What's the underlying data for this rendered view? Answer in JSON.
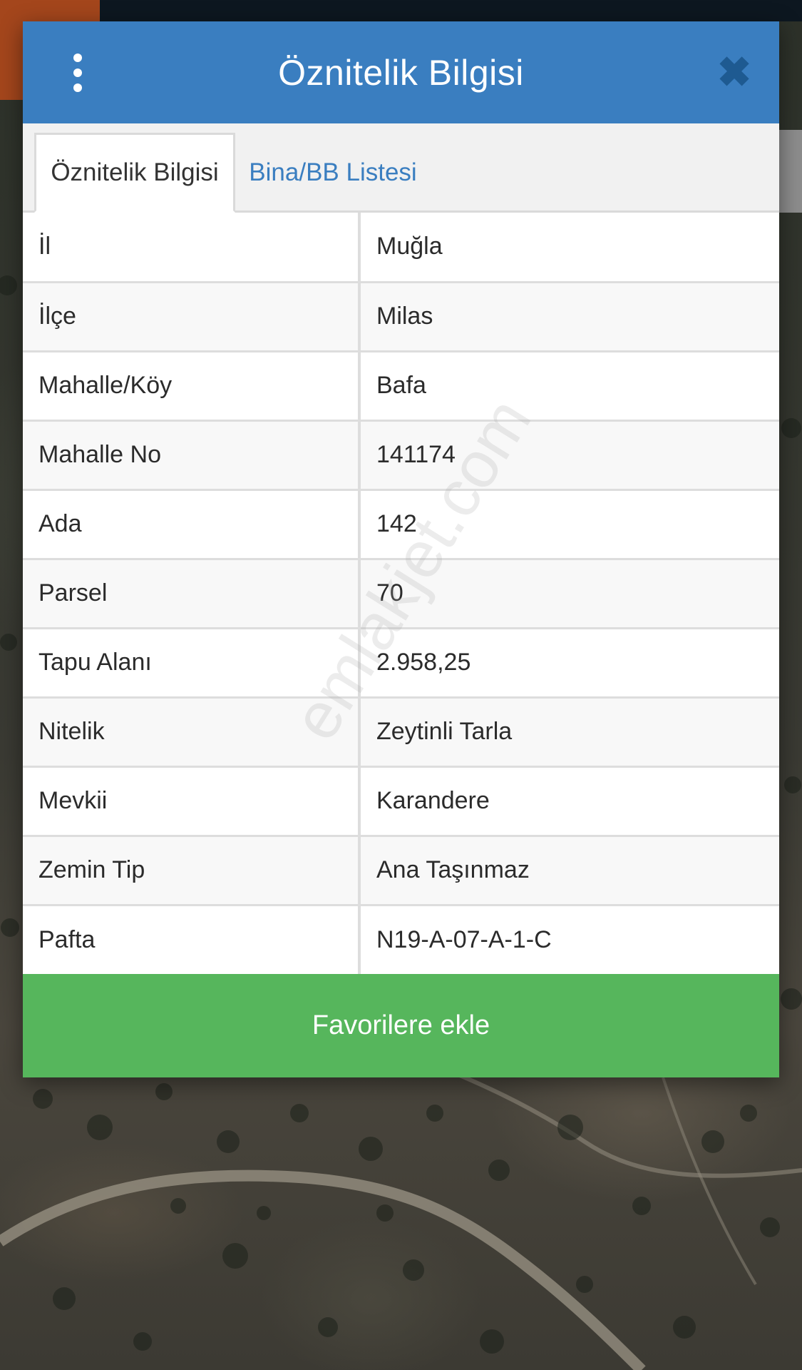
{
  "dialog": {
    "title": "Öznitelik Bilgisi",
    "menu_icon": "more-vertical-icon",
    "close_icon": "close-icon"
  },
  "tabs": [
    {
      "label": "Öznitelik Bilgisi",
      "active": true
    },
    {
      "label": "Bina/BB Listesi",
      "active": false
    }
  ],
  "attributes": [
    {
      "key": "İl",
      "value": "Muğla"
    },
    {
      "key": "İlçe",
      "value": "Milas"
    },
    {
      "key": "Mahalle/Köy",
      "value": "Bafa"
    },
    {
      "key": "Mahalle No",
      "value": "141174"
    },
    {
      "key": "Ada",
      "value": "142"
    },
    {
      "key": "Parsel",
      "value": "70"
    },
    {
      "key": "Tapu Alanı",
      "value": "2.958,25"
    },
    {
      "key": "Nitelik",
      "value": "Zeytinli Tarla"
    },
    {
      "key": "Mevkii",
      "value": "Karandere"
    },
    {
      "key": "Zemin Tip",
      "value": "Ana Taşınmaz"
    },
    {
      "key": "Pafta",
      "value": "N19-A-07-A-1-C"
    }
  ],
  "favorite_button": {
    "label": "Favorilere ekle"
  },
  "watermark": "emlakjet.com",
  "colors": {
    "header": "#3a7ec0",
    "accent_link": "#3a7ec0",
    "favorite": "#56b65c"
  }
}
